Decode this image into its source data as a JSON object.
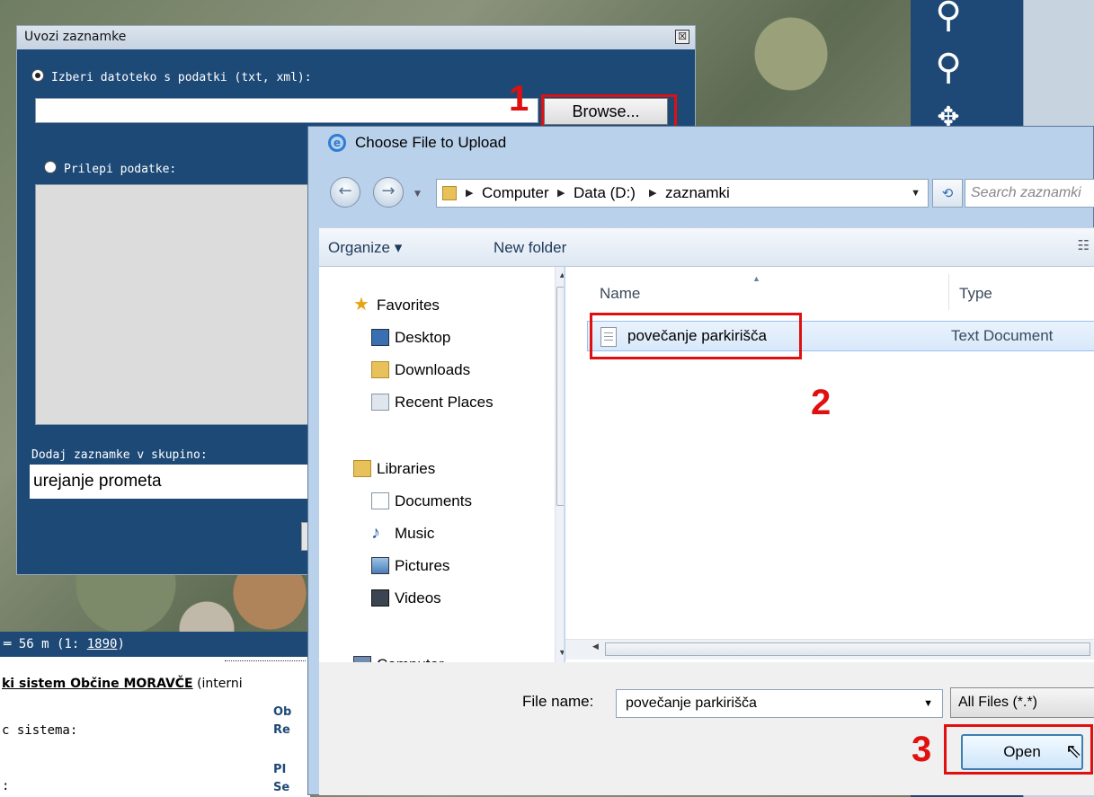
{
  "map": {
    "scale_prefix": "═ 56 m (1: ",
    "scale_value": "1890",
    "scale_suffix": ")",
    "info_title": "ki sistem Občine MORAVČE",
    "info_title_rest": " (interni",
    "info_label": "c sistema:",
    "info_label2": ":",
    "links": [
      "Ob",
      "Re",
      "PI",
      "Se"
    ],
    "tools": [
      "zoom-in-icon",
      "zoom-out-icon",
      "pan-icon"
    ]
  },
  "import_dialog": {
    "title": "Uvozi zaznamke",
    "close_glyph": "☒",
    "option_file_label": "Izberi datoteko s podatki (txt, xml):",
    "browse_label": "Browse...",
    "option_paste_label": "Prilepi podatke:",
    "group_label": "Dodaj zaznamke v skupino:",
    "group_value": "urejanje prometa"
  },
  "steps": [
    "1",
    "2",
    "3"
  ],
  "file_dialog": {
    "title": "Choose File to Upload",
    "breadcrumb": [
      "Computer",
      "Data (D:)",
      "zaznamki"
    ],
    "search_placeholder": "Search zaznamki",
    "toolbar": {
      "organize": "Organize ▾",
      "new_folder": "New folder"
    },
    "nav": [
      {
        "label": "Favorites",
        "icon": "star-icon"
      },
      {
        "label": "Desktop",
        "icon": "desktop-icon"
      },
      {
        "label": "Downloads",
        "icon": "downloads-icon"
      },
      {
        "label": "Recent Places",
        "icon": "recent-places-icon"
      },
      {
        "label": "Libraries",
        "icon": "libraries-icon"
      },
      {
        "label": "Documents",
        "icon": "documents-icon"
      },
      {
        "label": "Music",
        "icon": "music-icon"
      },
      {
        "label": "Pictures",
        "icon": "pictures-icon"
      },
      {
        "label": "Videos",
        "icon": "videos-icon"
      },
      {
        "label": "Computer",
        "icon": "computer-icon"
      }
    ],
    "columns": {
      "name": "Name",
      "type": "Type"
    },
    "files": [
      {
        "name": "povečanje parkirišča",
        "type": "Text Document"
      }
    ],
    "file_name_label": "File name:",
    "file_name_value": "povečanje parkirišča",
    "file_type_value": "All Files (*.*)",
    "open_label": "Open"
  }
}
